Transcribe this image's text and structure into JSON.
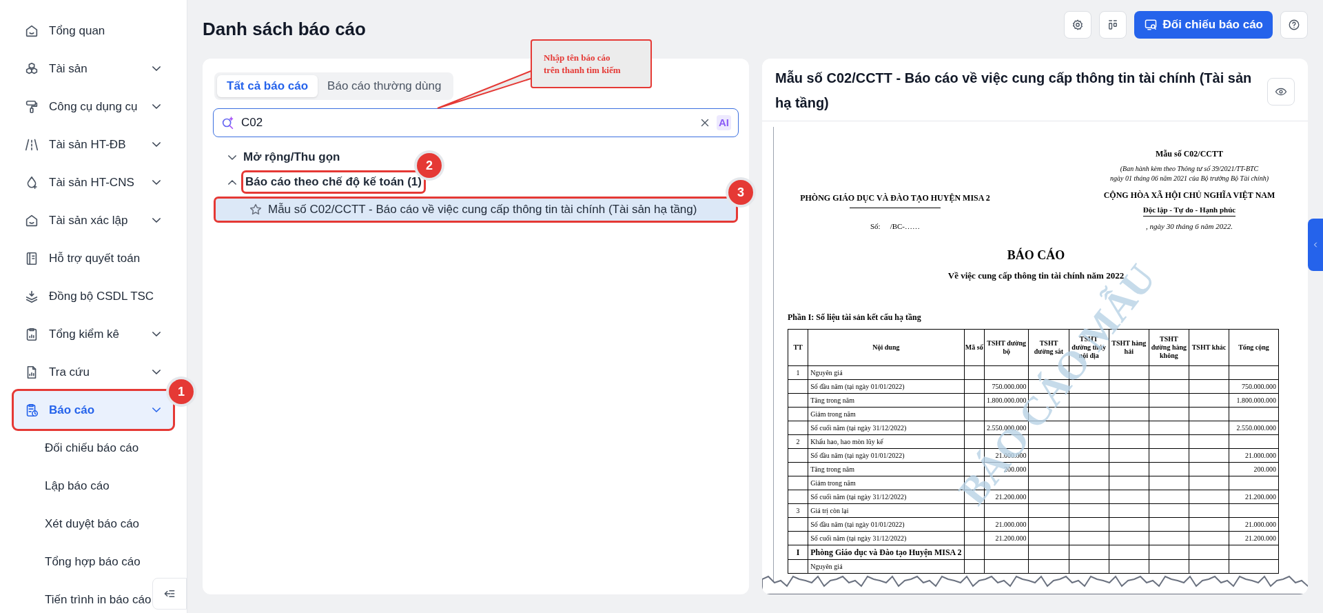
{
  "sidebar": {
    "items": [
      {
        "label": "Tổng quan",
        "expandable": false,
        "selected": false
      },
      {
        "label": "Tài sản",
        "expandable": true,
        "selected": false
      },
      {
        "label": "Công cụ dụng cụ",
        "expandable": true,
        "selected": false
      },
      {
        "label": "Tài sản HT-ĐB",
        "expandable": true,
        "selected": false
      },
      {
        "label": "Tài sản HT-CNS",
        "expandable": true,
        "selected": false
      },
      {
        "label": "Tài sản xác lập",
        "expandable": true,
        "selected": false
      },
      {
        "label": "Hỗ trợ quyết toán",
        "expandable": false,
        "selected": false
      },
      {
        "label": "Đồng bộ CSDL TSC",
        "expandable": false,
        "selected": false
      },
      {
        "label": "Tổng kiểm kê",
        "expandable": true,
        "selected": false
      },
      {
        "label": "Tra cứu",
        "expandable": true,
        "selected": false
      },
      {
        "label": "Báo cáo",
        "expandable": true,
        "selected": true,
        "children": [
          {
            "label": "Đối chiếu báo cáo"
          },
          {
            "label": "Lập báo cáo"
          },
          {
            "label": "Xét duyệt báo cáo"
          },
          {
            "label": "Tổng hợp báo cáo"
          },
          {
            "label": "Tiến trình in báo cáo"
          }
        ]
      }
    ]
  },
  "page_title": "Danh sách báo cáo",
  "toolbar": {
    "primary_button": "Đối chiếu báo cáo"
  },
  "tabs": [
    {
      "label": "Tất cả báo cáo",
      "selected": true
    },
    {
      "label": "Báo cáo thường dùng",
      "selected": false
    }
  ],
  "search": {
    "value": "C02",
    "ai_label": "AI"
  },
  "tree": {
    "toggle_label": "Mở rộng/Thu gọn",
    "groups": [
      {
        "label": "Báo cáo theo chế độ kế toán (1)",
        "expanded": true,
        "children": [
          {
            "label": "Mẫu số C02/CCTT - Báo cáo về việc cung cấp thông tin tài chính (Tài sản hạ tầng)",
            "selected": true,
            "starred": false
          }
        ]
      }
    ]
  },
  "preview": {
    "title": "Mẫu số C02/CCTT - Báo cáo về việc cung cấp thông tin tài chính (Tài sản hạ tầng)",
    "document": {
      "org": "PHÒNG GIÁO DỤC VÀ ĐÀO TẠO HUYỆN MISA 2",
      "number_label": "Số:",
      "number_value": "/BC-……",
      "form_no": "Mẫu số C02/CCTT",
      "issued_note": [
        "(Ban hành kèm theo Thông tư số 39/2021/TT-BTC",
        "ngày 01 tháng 06 năm 2021 của Bộ trưởng Bộ Tài chính)"
      ],
      "nation": "CỘNG HÒA XÃ HỘI CHỦ NGHĨA VIỆT NAM",
      "motto": "Độc lập - Tự do - Hạnh phúc",
      "date": ", ngày 30 tháng 6 năm 2022.",
      "heading": "BÁO CÁO",
      "subheading": "Về việc cung cấp thông tin tài chính năm 2022",
      "section": "Phần I: Số liệu tài sản kết cấu hạ tầng",
      "watermark": "BÁO CÁO MẪU",
      "columns": [
        "TT",
        "Nội dung",
        "Mã số",
        "TSHT đường bộ",
        "TSHT đường sắt",
        "TSHT đường thủy nội địa",
        "TSHT hàng hải",
        "TSHT đường hàng không",
        "TSHT khác",
        "Tổng cộng"
      ],
      "rows": [
        {
          "kind": "item",
          "tt": "1",
          "content": "Nguyên giá"
        },
        {
          "kind": "item",
          "content": "Số đầu năm (tại ngày 01/01/2022)",
          "road": "750.000.000",
          "total": "750.000.000"
        },
        {
          "kind": "item",
          "content": "Tăng trong năm",
          "road": "1.800.000.000",
          "total": "1.800.000.000"
        },
        {
          "kind": "item",
          "content": "Giảm trong năm"
        },
        {
          "kind": "item",
          "content": "Số cuối năm (tại ngày 31/12/2022)",
          "road": "2.550.000.000",
          "total": "2.550.000.000"
        },
        {
          "kind": "item",
          "tt": "2",
          "content": "Khấu hao, hao mòn lũy kế"
        },
        {
          "kind": "item",
          "content": "Số đầu năm (tại ngày 01/01/2022)",
          "road": "21.000.000",
          "total": "21.000.000"
        },
        {
          "kind": "item",
          "content": "Tăng trong năm",
          "road": "200.000",
          "total": "200.000"
        },
        {
          "kind": "item",
          "content": "Giảm trong năm"
        },
        {
          "kind": "item",
          "content": "Số cuối năm (tại ngày 31/12/2022)",
          "road": "21.200.000",
          "total": "21.200.000"
        },
        {
          "kind": "item",
          "tt": "3",
          "content": "Giá trị còn lại"
        },
        {
          "kind": "item",
          "content": "Số đầu năm (tại ngày 01/01/2022)",
          "road": "21.000.000",
          "total": "21.000.000"
        },
        {
          "kind": "item",
          "content": "Số cuối năm (tại ngày 31/12/2022)",
          "road": "21.200.000",
          "total": "21.200.000"
        },
        {
          "kind": "heading",
          "tt": "I",
          "content": "Phòng Giáo dục và Đào tạo Huyện MISA 2"
        },
        {
          "kind": "item",
          "content": "Nguyên giá"
        }
      ]
    }
  },
  "annotations": {
    "callout": [
      "Nhập tên báo cáo",
      "trên thanh tìm kiếm"
    ],
    "badges": [
      "1",
      "2",
      "3"
    ]
  }
}
